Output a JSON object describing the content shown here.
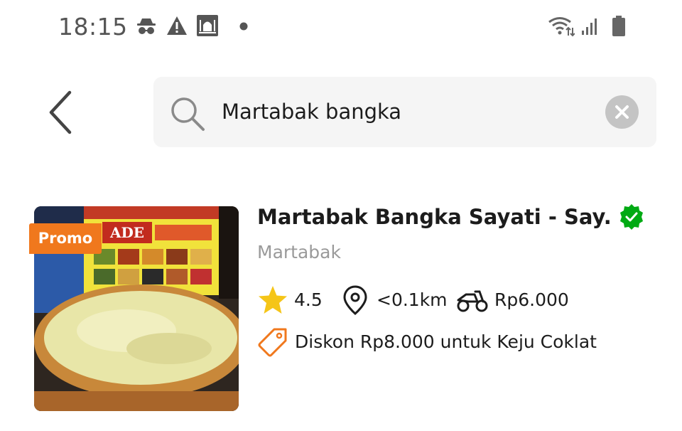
{
  "status_bar": {
    "time": "18:15",
    "left_icons": [
      "incognito-icon",
      "warning-icon",
      "mosque-icon",
      "dot-icon"
    ],
    "right_icons": [
      "wifi-icon",
      "signal-icon",
      "battery-icon"
    ]
  },
  "search": {
    "value": "Martabak bangka",
    "icons": [
      "back-arrow-icon",
      "search-icon",
      "clear-icon"
    ]
  },
  "result": {
    "promo_label": "Promo",
    "title": "Martabak Bangka Sayati - Say...",
    "category": "Martabak",
    "rating": "4.5",
    "distance": "<0.1km",
    "delivery_fee": "Rp6.000",
    "discount": "Diskon Rp8.000 untuk Keju Coklat",
    "image_sign_text": "ADE",
    "icons": [
      "verified-icon",
      "star-icon",
      "location-pin-icon",
      "motorbike-icon",
      "tag-icon"
    ]
  },
  "colors": {
    "promo": "#f0781d",
    "verified": "#00aa13",
    "star": "#f5c518",
    "tag": "#f0781d"
  }
}
